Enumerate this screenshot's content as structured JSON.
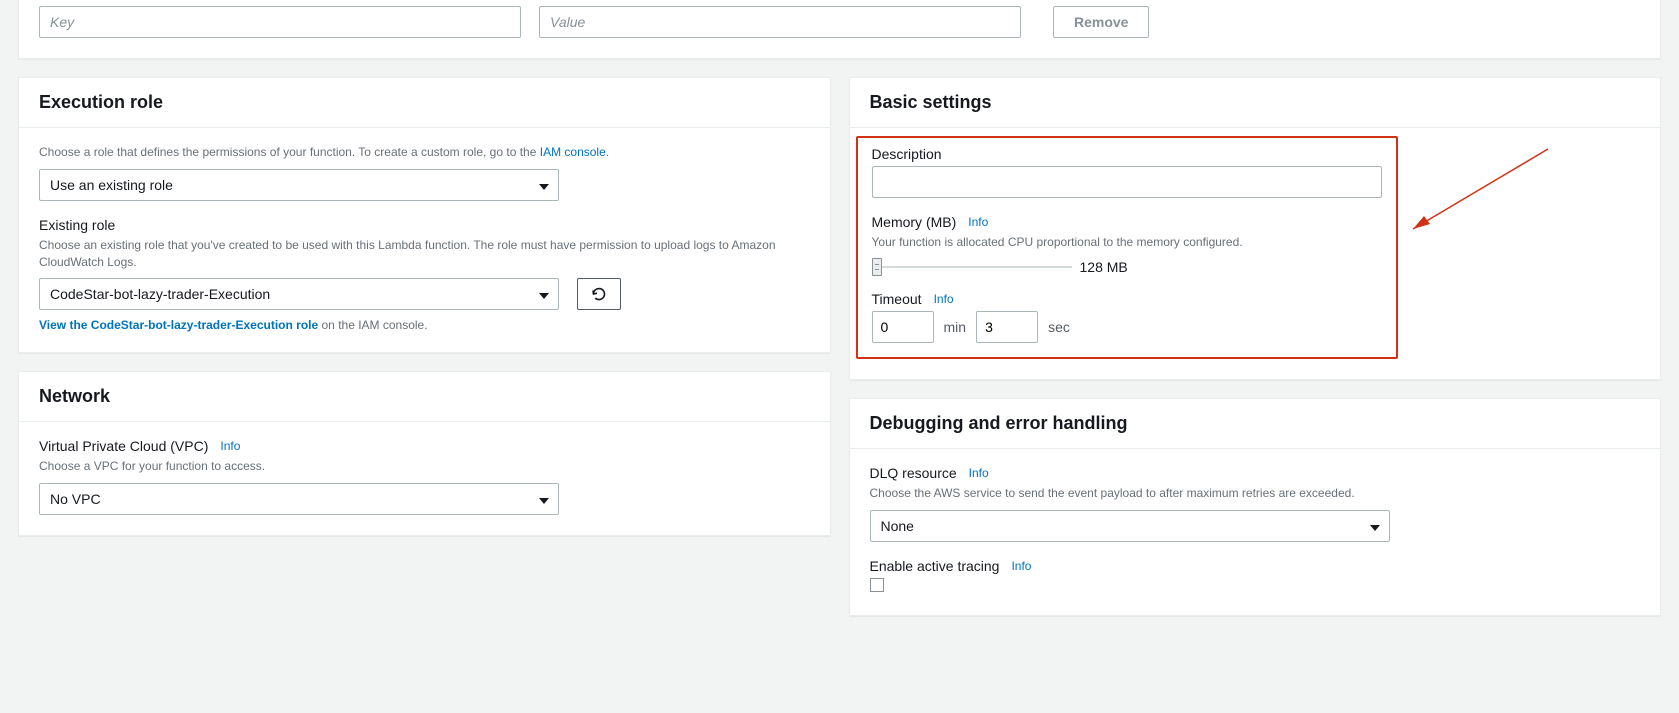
{
  "tags": {
    "key_placeholder": "Key",
    "value_placeholder": "Value",
    "remove_button": "Remove"
  },
  "execution_role": {
    "title": "Execution role",
    "description_prefix": "Choose a role that defines the permissions of your function. To create a custom role, go to the ",
    "description_link": "IAM console",
    "description_suffix": ".",
    "role_choice": "Use an existing role",
    "existing_role_label": "Existing role",
    "existing_role_help": "Choose an existing role that you've created to be used with this Lambda function. The role must have permission to upload logs to Amazon CloudWatch Logs.",
    "existing_role_value": "CodeStar-bot-lazy-trader-Execution",
    "view_link": "View the CodeStar-bot-lazy-trader-Execution role",
    "view_suffix": " on the IAM console."
  },
  "basic_settings": {
    "title": "Basic settings",
    "description_label": "Description",
    "description_value": "",
    "memory_label": "Memory (MB)",
    "memory_info": "Info",
    "memory_help": "Your function is allocated CPU proportional to the memory configured.",
    "memory_value": "128 MB",
    "timeout_label": "Timeout",
    "timeout_info": "Info",
    "timeout_min": "0",
    "timeout_min_label": "min",
    "timeout_sec": "3",
    "timeout_sec_label": "sec"
  },
  "network": {
    "title": "Network",
    "vpc_label": "Virtual Private Cloud (VPC)",
    "vpc_info": "Info",
    "vpc_help": "Choose a VPC for your function to access.",
    "vpc_value": "No VPC"
  },
  "debugging": {
    "title": "Debugging and error handling",
    "dlq_label": "DLQ resource",
    "dlq_info": "Info",
    "dlq_help": "Choose the AWS service to send the event payload to after maximum retries are exceeded.",
    "dlq_value": "None",
    "tracing_label": "Enable active tracing",
    "tracing_info": "Info"
  }
}
